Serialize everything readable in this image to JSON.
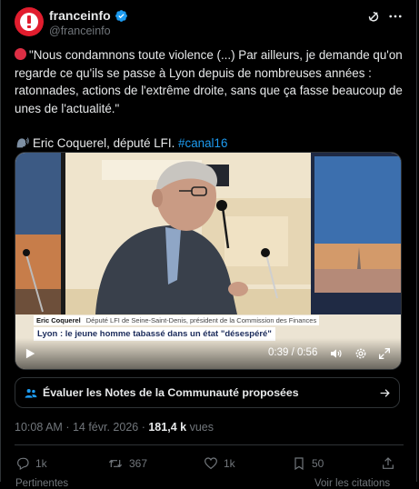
{
  "author": {
    "name": "franceinfo",
    "handle": "@franceinfo"
  },
  "tweet": {
    "paragraph1": "\"Nous condamnons toute violence (...) Par ailleurs, je demande qu'on regarde ce qu'ils se passe à Lyon depuis de nombreuses années : ratonnades, actions de l'extrême droite, sans que ça fasse beaucoup de unes de l'actualité.\"",
    "attribution": "Eric Coquerel, député LFI.",
    "hashtag": "#canal16"
  },
  "video": {
    "lower_third_name": "Eric Coquerel",
    "lower_third_role": "Député LFI de Seine-Saint-Denis, président de la Commission des Finances",
    "headline": "Lyon : le jeune homme tabassé dans un état \"désespéré\"",
    "time": "0:39 / 0:56"
  },
  "notes_prompt": "Évaluer les Notes de la Communauté proposées",
  "meta": {
    "time": "10:08 AM",
    "date": "14 févr. 2026",
    "views_count": "181,4 k",
    "views_label": "vues"
  },
  "actions": {
    "replies": "1k",
    "reposts": "367",
    "likes": "1k",
    "bookmarks": "50"
  },
  "footer_partial": {
    "left": "Pertinentes",
    "right": "Voir les citations"
  },
  "colors": {
    "accent": "#1d9bf0",
    "brand_red": "#e11d2e",
    "muted": "#71767b"
  }
}
